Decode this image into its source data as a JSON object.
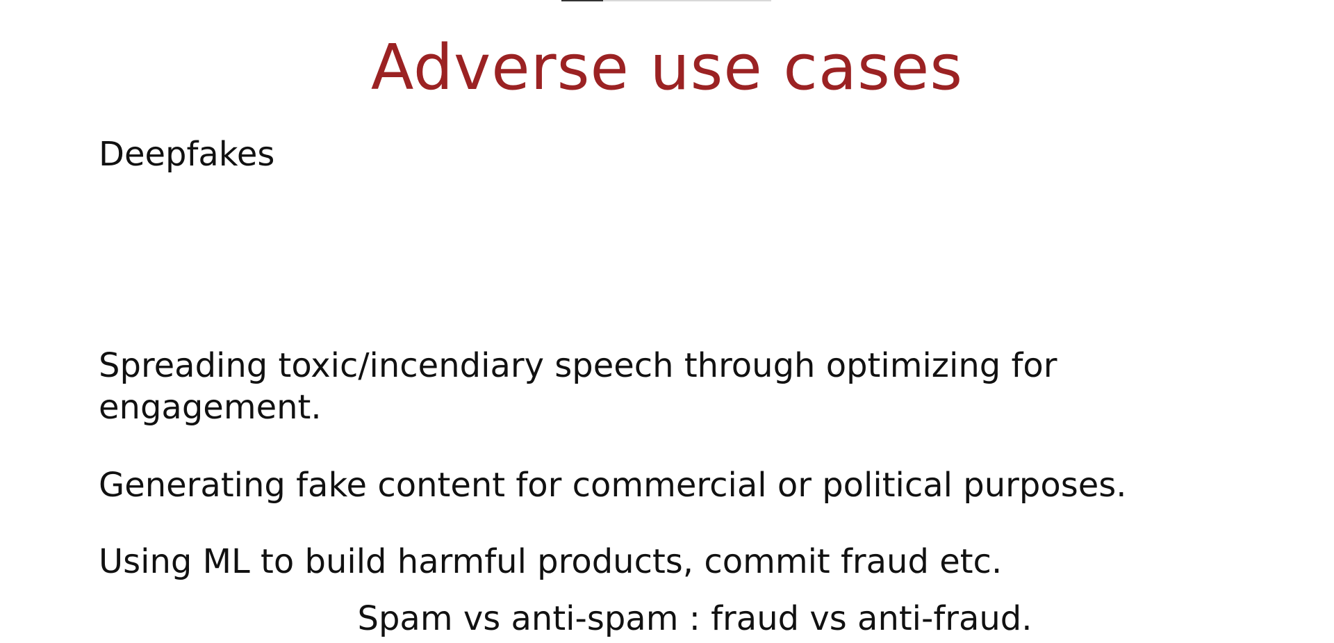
{
  "slide": {
    "title": "Adverse use cases",
    "bullets": [
      "Deepfakes",
      "Spreading toxic/incendiary speech through optimizing for",
      "engagement.",
      "Generating fake content for commercial or political purposes.",
      "Using ML to build harmful products, commit fraud etc."
    ],
    "footer": "Spam vs anti-spam : fraud vs anti-fraud."
  },
  "colors": {
    "title": "#9b2223",
    "text": "#111111",
    "background": "#ffffff"
  }
}
